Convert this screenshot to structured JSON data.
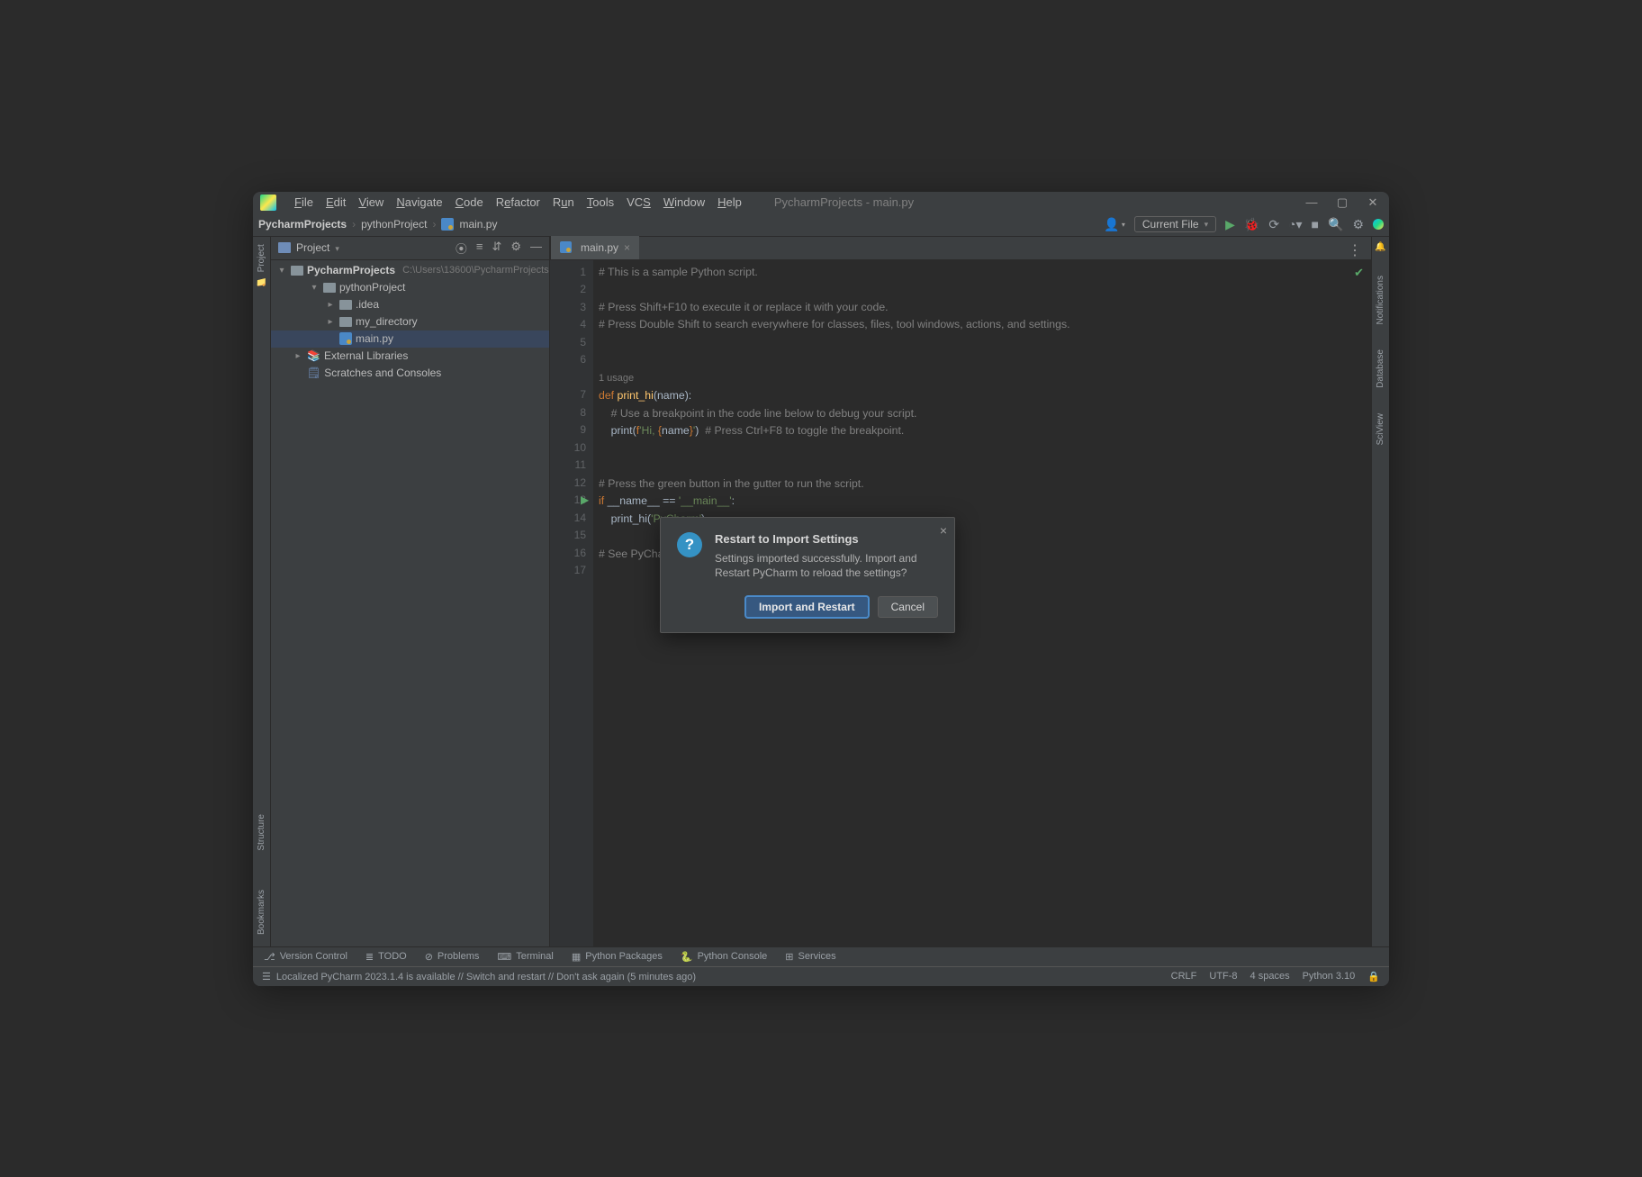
{
  "window_title": "PycharmProjects - main.py",
  "menus": [
    "File",
    "Edit",
    "View",
    "Navigate",
    "Code",
    "Refactor",
    "Run",
    "Tools",
    "VCS",
    "Window",
    "Help"
  ],
  "menu_underline_idx": [
    0,
    0,
    0,
    0,
    0,
    1,
    1,
    0,
    2,
    0,
    0
  ],
  "breadcrumbs": [
    "PycharmProjects",
    "pythonProject",
    "main.py"
  ],
  "run_config": "Current File",
  "sidebar": {
    "title": "Project",
    "root": {
      "name": "PycharmProjects",
      "path": "C:\\Users\\13600\\PycharmProjects"
    },
    "items": [
      {
        "indent": 1,
        "icon": "folder",
        "label": "pythonProject",
        "arrow": "down"
      },
      {
        "indent": 2,
        "icon": "folder",
        "label": ".idea",
        "arrow": "right"
      },
      {
        "indent": 2,
        "icon": "folder",
        "label": "my_directory",
        "arrow": "right"
      },
      {
        "indent": 2,
        "icon": "py",
        "label": "main.py",
        "selected": true
      },
      {
        "indent": 0,
        "icon": "lib",
        "label": "External Libraries",
        "arrow": "right"
      },
      {
        "indent": 0,
        "icon": "scratch",
        "label": "Scratches and Consoles"
      }
    ]
  },
  "left_tools": [
    "Project"
  ],
  "left_tools_bottom": [
    "Structure",
    "Bookmarks"
  ],
  "right_tools": [
    "Notifications",
    "Database",
    "SciView"
  ],
  "tab": {
    "label": "main.py"
  },
  "code_usage_label": "1 usage",
  "code_lines": [
    {
      "n": 1,
      "html": "<span class='c-comment'># This is a sample Python script.</span>"
    },
    {
      "n": 2,
      "html": ""
    },
    {
      "n": 3,
      "html": "<span class='c-comment'># Press Shift+F10 to execute it or replace it with your code.</span>"
    },
    {
      "n": 4,
      "html": "<span class='c-comment'># Press Double Shift to search everywhere for classes, files, tool windows, actions, and settings.</span>"
    },
    {
      "n": 5,
      "html": ""
    },
    {
      "n": 6,
      "html": ""
    },
    {
      "n": 7,
      "html": "<span class='c-key'>def </span><span class='c-func'>print_hi</span>(name):",
      "pre_usage": true
    },
    {
      "n": 8,
      "html": "    <span class='c-comment'># Use a breakpoint in the code line below to debug your script.</span>"
    },
    {
      "n": 9,
      "html": "    print(<span class='c-key'>f</span><span class='c-str'>'Hi, </span><span class='c-brace'>{</span>name<span class='c-brace'>}</span><span class='c-str'>'</span>)  <span class='c-comment'># Press Ctrl+F8 to toggle the breakpoint.</span>"
    },
    {
      "n": 10,
      "html": ""
    },
    {
      "n": 11,
      "html": ""
    },
    {
      "n": 12,
      "html": "<span class='c-comment'># Press the green button in the gutter to run the script.</span>"
    },
    {
      "n": 13,
      "html": "<span class='c-key'>if</span> __name__ == <span class='c-str'>'__main__'</span>:",
      "run": true
    },
    {
      "n": 14,
      "html": "    print_hi(<span class='c-str'>'PyCharm'</span>)"
    },
    {
      "n": 15,
      "html": ""
    },
    {
      "n": 16,
      "html": "<span class='c-comment'># See PyCharm help at https://www.jetbrains.com/help/pycharm/</span>"
    },
    {
      "n": 17,
      "html": ""
    }
  ],
  "bottom_tools": [
    "Version Control",
    "TODO",
    "Problems",
    "Terminal",
    "Python Packages",
    "Python Console",
    "Services"
  ],
  "statusbar": {
    "left": "Localized PyCharm 2023.1.4 is available // Switch and restart // Don't ask again (5 minutes ago)",
    "right": [
      "CRLF",
      "UTF-8",
      "4 spaces",
      "Python 3.10"
    ]
  },
  "dialog": {
    "title": "Restart to Import Settings",
    "message": "Settings imported successfully. Import and Restart PyCharm to reload the settings?",
    "primary_btn": "Import and Restart",
    "cancel_btn": "Cancel"
  }
}
